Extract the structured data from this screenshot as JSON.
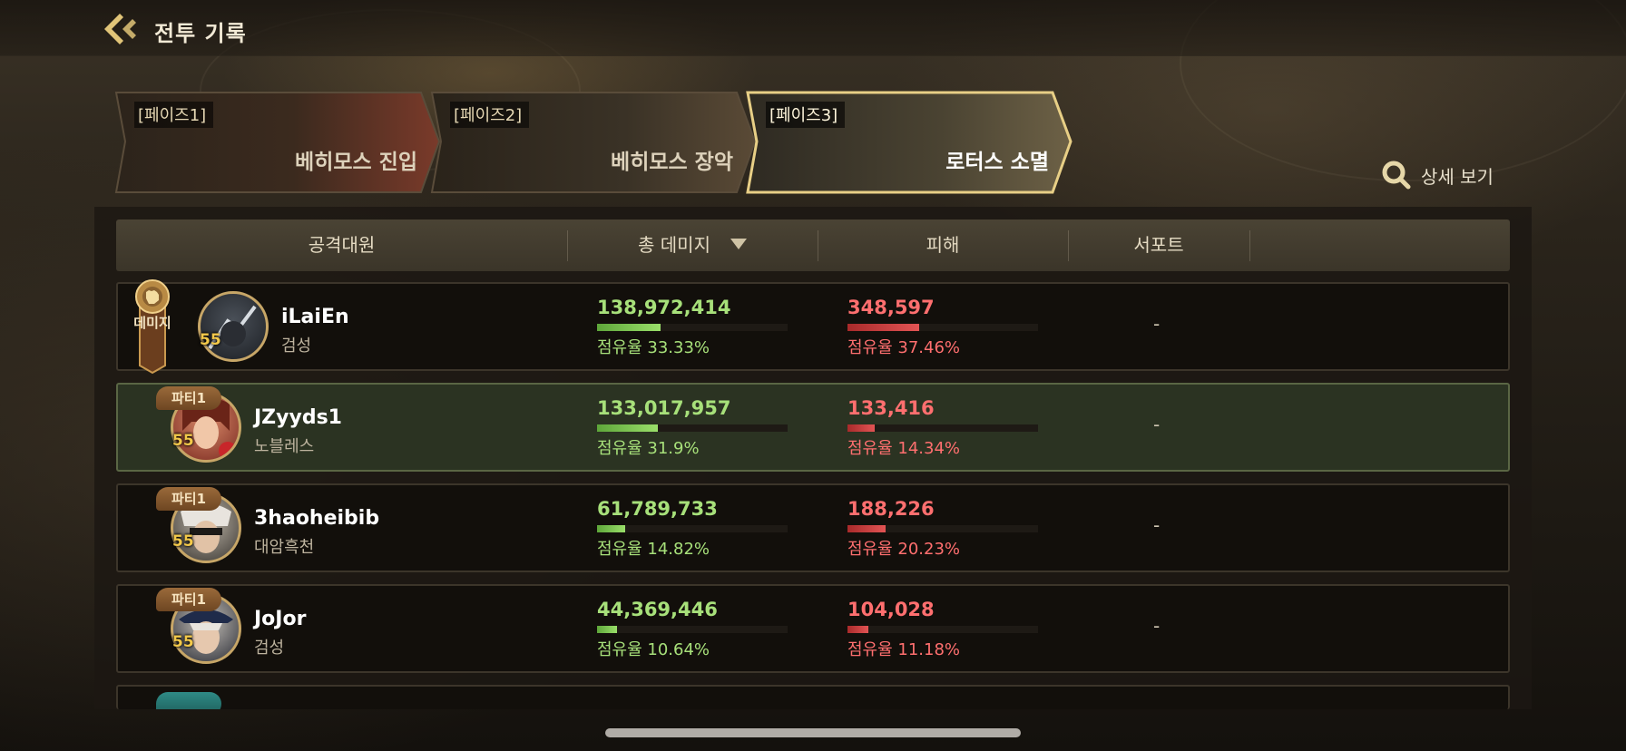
{
  "header": {
    "title": "전투 기록"
  },
  "tabs": [
    {
      "code": "[페이즈1]",
      "name": "베히모스 진입",
      "active": false
    },
    {
      "code": "[페이즈2]",
      "name": "베히모스 장악",
      "active": false
    },
    {
      "code": "[페이즈3]",
      "name": "로터스 소멸",
      "active": true
    }
  ],
  "detail": {
    "label": "상세 보기"
  },
  "columns": {
    "attacker": "공격대원",
    "damage": "총 데미지",
    "taken": "피해",
    "support": "서포트"
  },
  "rows": [
    {
      "name": "iLaiEn",
      "class": "검성",
      "level": "55",
      "party": "",
      "damage": "138,972,414",
      "damage_share": "점유율 33.33%",
      "damage_ratio": 0.3333,
      "taken": "348,597",
      "taken_share": "점유율 37.46%",
      "taken_ratio": 0.3746,
      "support": "-",
      "medal": "데미지",
      "highlight": false
    },
    {
      "name": "JZyyds1",
      "class": "노블레스",
      "level": "55",
      "party": "파티1",
      "damage": "133,017,957",
      "damage_share": "점유율 31.9%",
      "damage_ratio": 0.319,
      "taken": "133,416",
      "taken_share": "점유율 14.34%",
      "taken_ratio": 0.1434,
      "support": "-",
      "highlight": true
    },
    {
      "name": "3haoheibib",
      "class": "대암흑천",
      "level": "55",
      "party": "파티1",
      "damage": "61,789,733",
      "damage_share": "점유율 14.82%",
      "damage_ratio": 0.1482,
      "taken": "188,226",
      "taken_share": "점유율 20.23%",
      "taken_ratio": 0.2023,
      "support": "-",
      "highlight": false
    },
    {
      "name": "JoJor",
      "class": "검성",
      "level": "55",
      "party": "파티1",
      "damage": "44,369,446",
      "damage_share": "점유율 10.64%",
      "damage_ratio": 0.1064,
      "taken": "104,028",
      "taken_share": "점유율 11.18%",
      "taken_ratio": 0.1118,
      "support": "-",
      "highlight": false
    }
  ],
  "colors": {
    "damage": "#a7e07a",
    "taken": "#ff6f6f",
    "gold": "#c7a667",
    "my_row": "#2b3322"
  }
}
